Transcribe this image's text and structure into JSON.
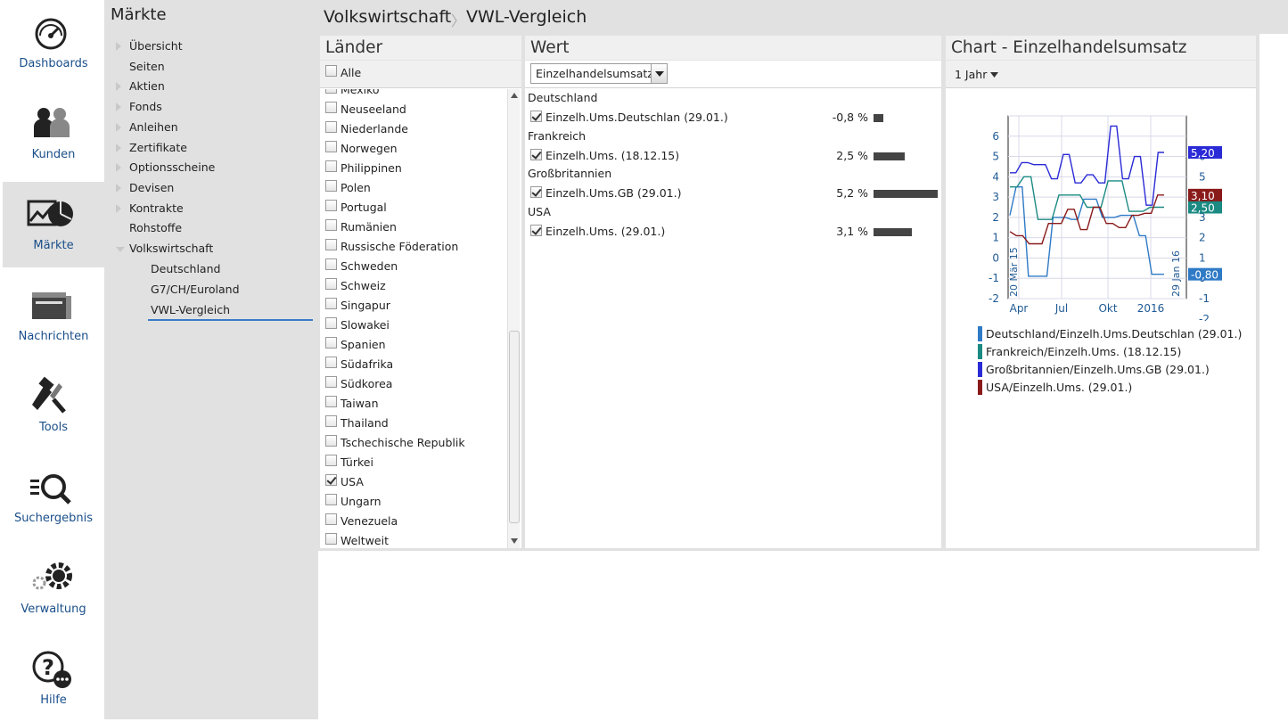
{
  "nav": [
    {
      "label": "Dashboards",
      "icon": "dashboard-gauge-icon"
    },
    {
      "label": "Kunden",
      "icon": "customers-icon"
    },
    {
      "label": "Märkte",
      "icon": "markets-chart-icon",
      "active": true
    },
    {
      "label": "Nachrichten",
      "icon": "news-icon"
    },
    {
      "label": "Tools",
      "icon": "tools-icon"
    },
    {
      "label": "Suchergebnis",
      "icon": "search-results-icon"
    },
    {
      "label": "Verwaltung",
      "icon": "settings-gears-icon"
    },
    {
      "label": "Hilfe",
      "icon": "help-icon"
    }
  ],
  "sidemenu": {
    "title": "Märkte",
    "items": [
      {
        "label": "Übersicht",
        "arrow": true
      },
      {
        "label": "Seiten",
        "arrow": false
      },
      {
        "label": "Aktien",
        "arrow": true
      },
      {
        "label": "Fonds",
        "arrow": true
      },
      {
        "label": "Anleihen",
        "arrow": true
      },
      {
        "label": "Zertifikate",
        "arrow": true
      },
      {
        "label": "Optionsscheine",
        "arrow": true
      },
      {
        "label": "Devisen",
        "arrow": true
      },
      {
        "label": "Kontrakte",
        "arrow": true
      },
      {
        "label": "Rohstoffe",
        "arrow": false
      },
      {
        "label": "Volkswirtschaft",
        "arrow": "down"
      }
    ],
    "subitems": [
      "Deutschland",
      "G7/CH/Euroland",
      "VWL-Vergleich"
    ],
    "selected_sub": "VWL-Vergleich"
  },
  "breadcrumb": {
    "first": "Volkswirtschaft",
    "separator": "〉",
    "second": "VWL-Vergleich"
  },
  "laender": {
    "title": "Länder",
    "all_label": "Alle",
    "items": [
      {
        "label": "Mexiko",
        "checked": false
      },
      {
        "label": "Neuseeland",
        "checked": false
      },
      {
        "label": "Niederlande",
        "checked": false
      },
      {
        "label": "Norwegen",
        "checked": false
      },
      {
        "label": "Philippinen",
        "checked": false
      },
      {
        "label": "Polen",
        "checked": false
      },
      {
        "label": "Portugal",
        "checked": false
      },
      {
        "label": "Rumänien",
        "checked": false
      },
      {
        "label": "Russische Föderation",
        "checked": false
      },
      {
        "label": "Schweden",
        "checked": false
      },
      {
        "label": "Schweiz",
        "checked": false
      },
      {
        "label": "Singapur",
        "checked": false
      },
      {
        "label": "Slowakei",
        "checked": false
      },
      {
        "label": "Spanien",
        "checked": false
      },
      {
        "label": "Südafrika",
        "checked": false
      },
      {
        "label": "Südkorea",
        "checked": false
      },
      {
        "label": "Taiwan",
        "checked": false
      },
      {
        "label": "Thailand",
        "checked": false
      },
      {
        "label": "Tschechische Republik",
        "checked": false
      },
      {
        "label": "Türkei",
        "checked": false
      },
      {
        "label": "USA",
        "checked": true
      },
      {
        "label": "Ungarn",
        "checked": false
      },
      {
        "label": "Venezuela",
        "checked": false
      },
      {
        "label": "Weltweit",
        "checked": false
      }
    ]
  },
  "wert": {
    "title": "Wert",
    "select_value": "Einzelhandelsumsatz",
    "groups": [
      {
        "country": "Deutschland",
        "row": "Einzelh.Ums.Deutschlan (29.01.)",
        "pct": "-0,8 %",
        "value": -0.8
      },
      {
        "country": "Frankreich",
        "row": "Einzelh.Ums. (18.12.15)",
        "pct": "2,5 %",
        "value": 2.5
      },
      {
        "country": "Großbritannien",
        "row": "Einzelh.Ums.GB (29.01.)",
        "pct": "5,2 %",
        "value": 5.2
      },
      {
        "country": "USA",
        "row": "Einzelh.Ums. (29.01.)",
        "pct": "3,1 %",
        "value": 3.1
      }
    ]
  },
  "chart_panel": {
    "title": "Chart - Einzelhandelsumsatz",
    "range": "1 Jahr"
  },
  "chart_data": {
    "type": "line",
    "x_ticks": [
      "Apr",
      "Jul",
      "Okt",
      "2016"
    ],
    "x_start_label": "20 Mär 15",
    "x_end_label": "29 Jan 16",
    "ylim": [
      -2,
      7
    ],
    "y_ticks": [
      "-2",
      "-1",
      "0",
      "1",
      "2",
      "3",
      "4",
      "5",
      "6"
    ],
    "grid": true,
    "legend_position": "bottom",
    "series": [
      {
        "name": "Deutschland/Einzelh.Ums.Deutschlan (29.01.)",
        "color": "#2e7ac6",
        "last_label": "-0,80",
        "y": [
          2.1,
          3.5,
          3.5,
          -0.9,
          -0.9,
          -0.9,
          -0.9,
          2.0,
          2.0,
          2.0,
          1.9,
          1.9,
          2.9,
          2.9,
          2.9,
          2.0,
          2.0,
          2.0,
          2.1,
          2.1,
          2.1,
          1.1,
          1.1,
          -0.8,
          -0.8,
          -0.8
        ]
      },
      {
        "name": "Frankreich/Einzelh.Ums. (18.12.15)",
        "color": "#1a8a82",
        "last_label": "2,50",
        "y": [
          3.5,
          3.5,
          4.0,
          4.0,
          1.9,
          1.9,
          1.9,
          3.1,
          3.1,
          3.1,
          3.1,
          2.5,
          2.5,
          2.5,
          3.8,
          3.8,
          3.8,
          2.3,
          2.3,
          2.3,
          2.5,
          2.5,
          2.5
        ]
      },
      {
        "name": "Großbritannien/Einzelh.Ums.GB (29.01.)",
        "color": "#2a2ad6",
        "last_label": "5,20",
        "y": [
          4.2,
          4.2,
          4.7,
          4.7,
          4.6,
          4.6,
          4.6,
          3.9,
          3.9,
          5.1,
          5.1,
          3.7,
          3.7,
          4.1,
          4.1,
          3.7,
          3.7,
          6.5,
          6.5,
          3.9,
          3.9,
          5.0,
          5.0,
          2.6,
          2.6,
          5.2,
          5.2
        ]
      },
      {
        "name": "USA/Einzelh.Ums. (29.01.)",
        "color": "#8a1a1a",
        "last_label": "3,10",
        "y": [
          1.3,
          1.1,
          1.1,
          0.7,
          0.7,
          0.7,
          1.7,
          1.7,
          1.7,
          2.4,
          2.4,
          1.4,
          1.4,
          2.5,
          2.5,
          1.7,
          1.7,
          1.5,
          1.5,
          2.1,
          2.1,
          2.2,
          2.2,
          3.1,
          3.1
        ]
      }
    ]
  }
}
